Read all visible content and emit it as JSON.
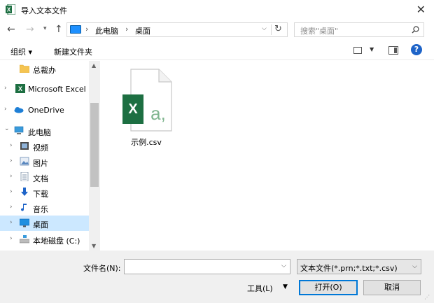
{
  "window": {
    "title": "导入文本文件",
    "close_glyph": "✕"
  },
  "nav": {
    "back": "←",
    "forward": "→",
    "recent": "▾",
    "up": "↑"
  },
  "address": {
    "separator": "›",
    "segments": [
      "此电脑",
      "桌面"
    ],
    "dropdown": "⌵",
    "refresh": "↻"
  },
  "search": {
    "placeholder": "搜索\"桌面\""
  },
  "toolbar": {
    "organize": "组织 ▾",
    "new_folder": "新建文件夹",
    "view_dropdown": "▼",
    "help": "?"
  },
  "tree": [
    {
      "label": "总裁办",
      "icon": "folder-icon",
      "chevron": "",
      "selected": false
    },
    {
      "label": "Microsoft Excel",
      "icon": "excel-icon",
      "chevron": "›",
      "selected": false
    },
    {
      "label": "OneDrive",
      "icon": "onedrive-icon",
      "chevron": "›",
      "selected": false
    },
    {
      "label": "此电脑",
      "icon": "this-pc-icon",
      "chevron": "⌄",
      "selected": false
    },
    {
      "label": "视频",
      "icon": "video-folder-icon",
      "chevron": "›",
      "selected": false
    },
    {
      "label": "图片",
      "icon": "pictures-folder-icon",
      "chevron": "›",
      "selected": false
    },
    {
      "label": "文档",
      "icon": "documents-folder-icon",
      "chevron": "›",
      "selected": false
    },
    {
      "label": "下载",
      "icon": "downloads-folder-icon",
      "chevron": "›",
      "selected": false
    },
    {
      "label": "音乐",
      "icon": "music-folder-icon",
      "chevron": "›",
      "selected": false
    },
    {
      "label": "桌面",
      "icon": "desktop-folder-icon",
      "chevron": "›",
      "selected": true
    },
    {
      "label": "本地磁盘 (C:)",
      "icon": "local-disk-icon",
      "chevron": "›",
      "selected": false
    }
  ],
  "scrollbar": {
    "up": "▲",
    "down": "▼"
  },
  "files": [
    {
      "name": "示例.csv",
      "icon": "excel-csv-file-icon",
      "excel_letter": "X",
      "glyph": "a,"
    }
  ],
  "bottom": {
    "filename_label": "文件名(N):",
    "filename_value": "",
    "dropdown": "⌵",
    "filter": "文本文件(*.prn;*.txt;*.csv)",
    "tools": "工具(L)",
    "tools_dropdown": "▼",
    "open": "打开(O)",
    "cancel": "取消",
    "grip": "⋰"
  },
  "colors": {
    "excel_green": "#1d6f42",
    "accent": "#0078d7",
    "selected_bg": "#cce8ff"
  }
}
